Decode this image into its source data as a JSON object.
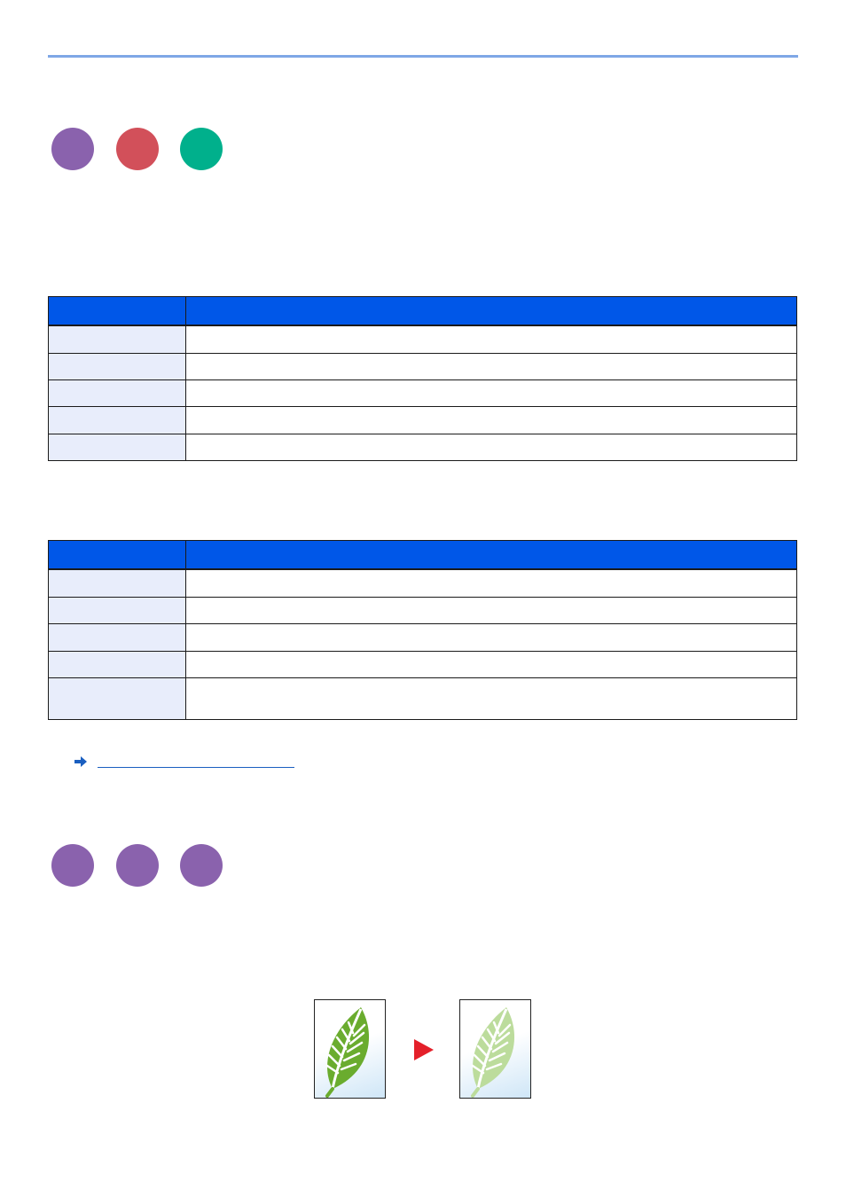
{
  "colors": {
    "rule": "#7fa7e6",
    "table_header": "#0057e8",
    "label_cell": "#e8edfb",
    "purple": "#8a62ad",
    "red": "#d2505a",
    "green": "#00b08c",
    "link": "#1a5fc0",
    "arrow_red": "#e4202a"
  },
  "section1": {
    "dots": [
      {
        "name": "purple-dot",
        "color": "#8a62ad"
      },
      {
        "name": "red-dot",
        "color": "#d2505a"
      },
      {
        "name": "green-dot",
        "color": "#00b08c"
      }
    ]
  },
  "table1": {
    "rows": 5
  },
  "table2": {
    "rows": 5
  },
  "reference_link": {
    "icon": "arrow-right-icon"
  },
  "section2": {
    "dots": [
      {
        "name": "purple-dot",
        "color": "#8a62ad"
      },
      {
        "name": "purple-dot",
        "color": "#8a62ad"
      },
      {
        "name": "purple-dot",
        "color": "#8a62ad"
      }
    ]
  },
  "illustration": {
    "before": "leaf-icon",
    "arrow": "play-arrow-icon",
    "after": "faded-leaf-icon"
  }
}
